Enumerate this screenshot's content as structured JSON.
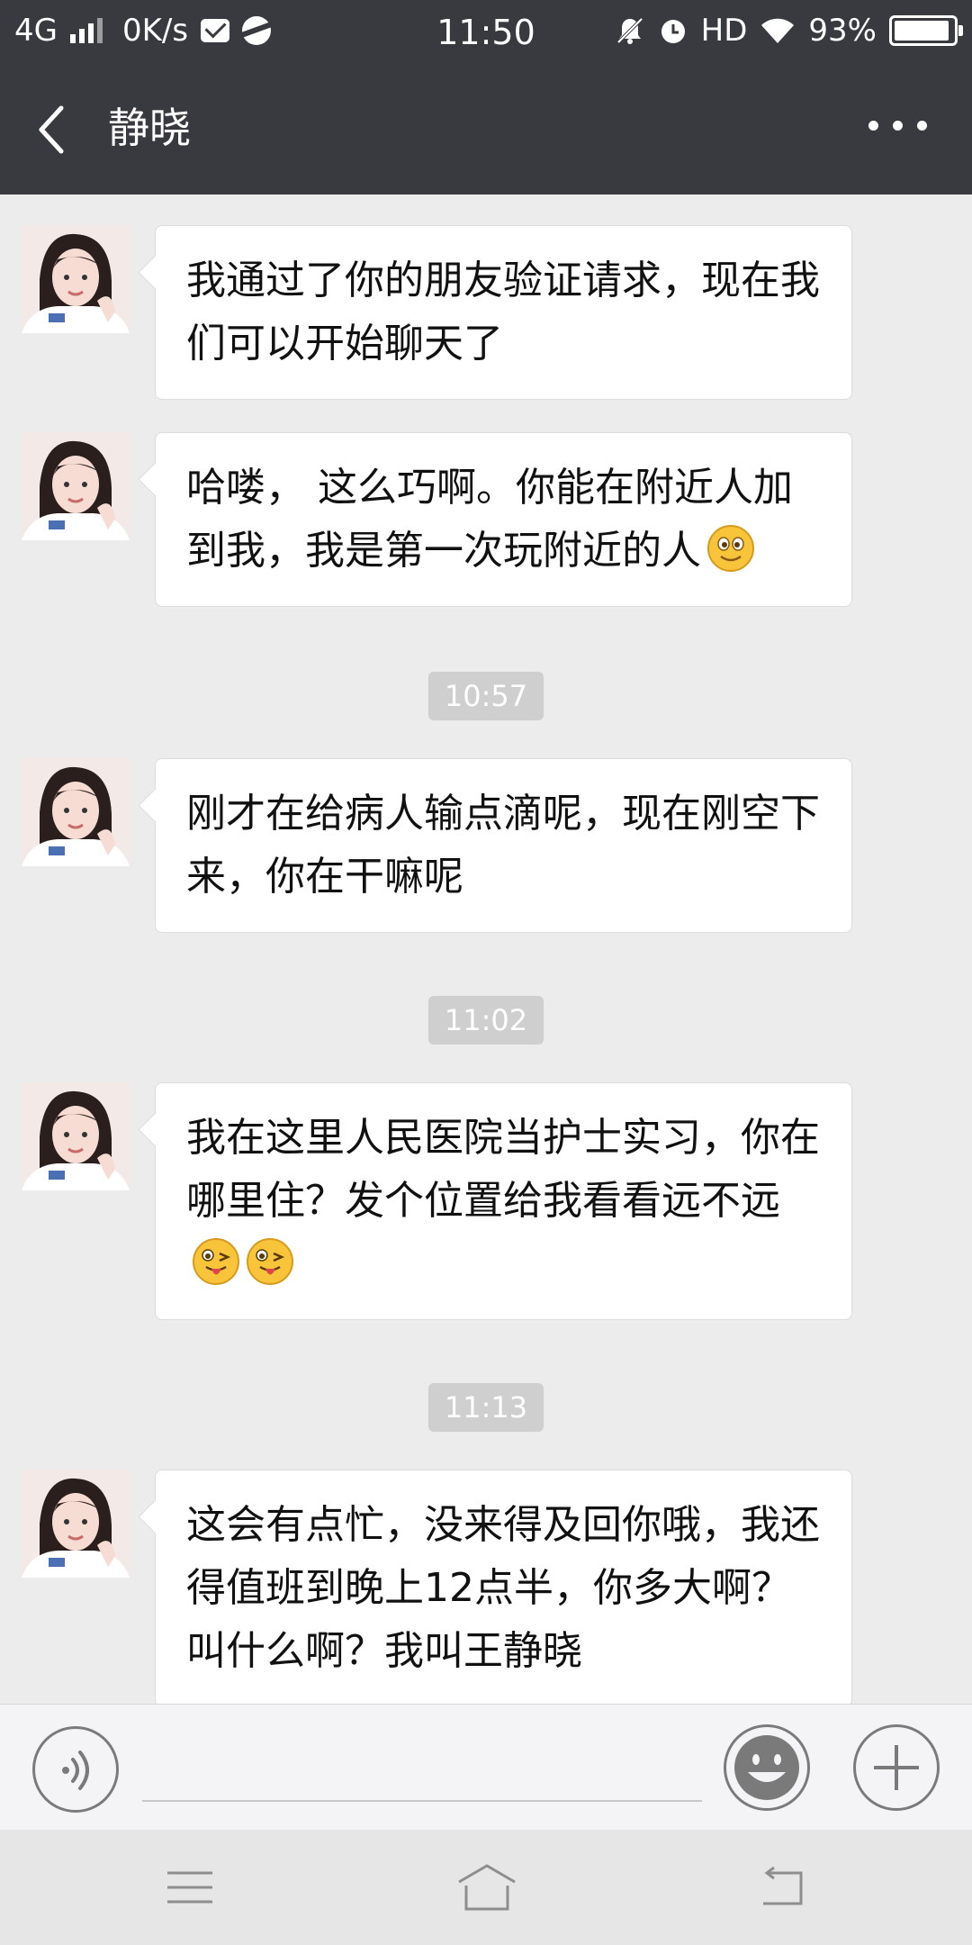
{
  "status_bar": {
    "network": "4G",
    "speed": "0K/s",
    "time": "11:50",
    "hd": "HD",
    "battery": "93%",
    "battery_level": 0.93
  },
  "header": {
    "title": "静晓",
    "back_icon": "chevron-left-icon",
    "more_icon": "more-dots-icon"
  },
  "messages": [
    {
      "type": "text",
      "text": "我通过了你的朋友验证请求，现在我们可以开始聊天了"
    },
    {
      "type": "text",
      "text": "哈喽， 这么巧啊。你能在附近人加到我，我是第一次玩附近的人",
      "emoji": [
        "smile-emoji"
      ]
    },
    {
      "type": "time",
      "text": "10:57"
    },
    {
      "type": "text",
      "text": "刚才在给病人输点滴呢，现在刚空下来，你在干嘛呢"
    },
    {
      "type": "time",
      "text": "11:02"
    },
    {
      "type": "text",
      "text": "我在这里人民医院当护士实习，你在哪里住？发个位置给我看看远不远",
      "emoji": [
        "tongue-wink-emoji",
        "tongue-wink-emoji"
      ]
    },
    {
      "type": "time",
      "text": "11:13"
    },
    {
      "type": "text",
      "text": "这会有点忙，没来得及回你哦，我还得值班到晚上12点半，你多大啊？叫什么啊？我叫王静晓"
    }
  ],
  "input_bar": {
    "voice_icon": "voice-icon",
    "emoji_icon": "emoji-icon",
    "plus_icon": "plus-icon",
    "value": ""
  },
  "nav_bar": {
    "menu_icon": "menu-icon",
    "home_icon": "home-icon",
    "back_icon": "return-icon"
  },
  "colors": {
    "header_bg": "#393a3f",
    "chat_bg": "#ececec",
    "bubble_bg": "#ffffff",
    "timestamp_bg": "#cfcfcf"
  }
}
